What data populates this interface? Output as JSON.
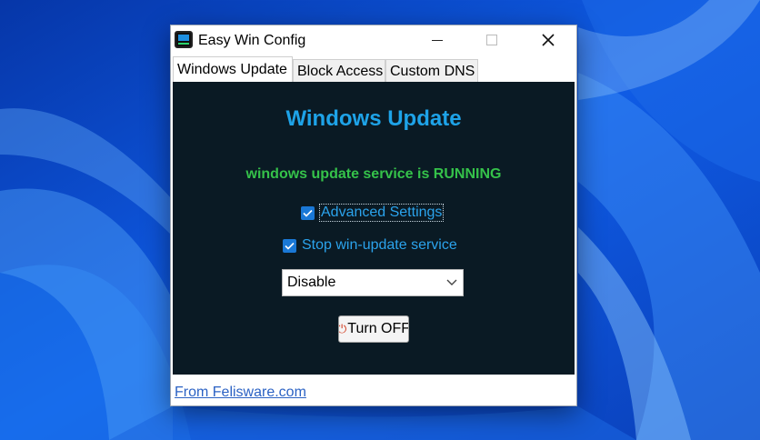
{
  "window": {
    "title": "Easy Win Config"
  },
  "icons": {
    "app": "app-monitor-icon",
    "minimize": "minimize-icon",
    "maximize": "maximize-icon",
    "close": "close-icon",
    "checkbox": "check-icon",
    "dropdown": "chevron-down-icon",
    "power": "power-icon"
  },
  "tabs": [
    {
      "label": "Windows Update",
      "active": true
    },
    {
      "label": "Block Access",
      "active": false
    },
    {
      "label": "Custom DNS",
      "active": false
    }
  ],
  "panel": {
    "heading": "Windows Update",
    "status": "windows update service is RUNNING",
    "advanced_settings": {
      "label": "Advanced Settings",
      "checked": true
    },
    "stop_service": {
      "label": "Stop win-update service",
      "checked": true
    },
    "mode_select": {
      "value": "Disable"
    },
    "turn_off_label": "Turn OFF"
  },
  "footer": {
    "link": "From Felisware.com"
  },
  "colors": {
    "panel_bg": "#0a1a24",
    "heading": "#1ea3e8",
    "status_running": "#35c24a",
    "checkbox_accent": "#1a78d6",
    "link": "#2b62c4"
  }
}
